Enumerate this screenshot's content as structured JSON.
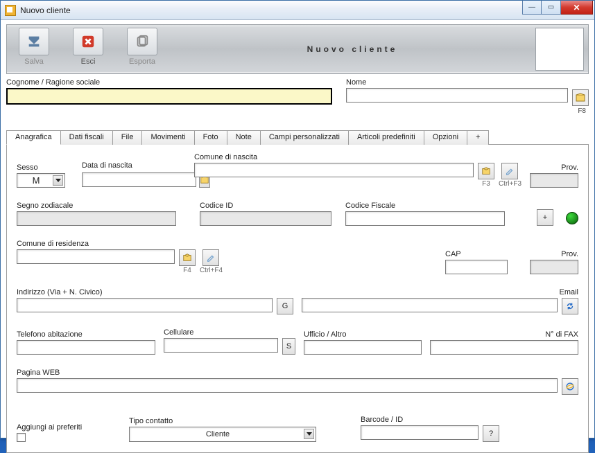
{
  "window": {
    "title": "Nuovo cliente"
  },
  "toolbar": {
    "save": "Salva",
    "exit": "Esci",
    "export": "Esporta",
    "title": "Nuovo cliente"
  },
  "top": {
    "cognome_label": "Cognome / Ragione sociale",
    "cognome_value": "",
    "nome_label": "Nome",
    "nome_value": "",
    "f8": "F8"
  },
  "tabs": {
    "anagrafica": "Anagrafica",
    "dati_fiscali": "Dati fiscali",
    "file": "File",
    "movimenti": "Movimenti",
    "foto": "Foto",
    "note": "Note",
    "campi": "Campi personalizzati",
    "articoli": "Articoli predefiniti",
    "opzioni": "Opzioni",
    "plus": "+"
  },
  "anag": {
    "sesso_label": "Sesso",
    "sesso_value": "M",
    "dn_label": "Data di nascita",
    "comune_nascita_label": "Comune di nascita",
    "prov_label": "Prov.",
    "f3": "F3",
    "ctrlf3": "Ctrl+F3",
    "zodiaco_label": "Segno zodiacale",
    "codiceid_label": "Codice ID",
    "cf_label": "Codice Fiscale",
    "plus": "+",
    "comune_res_label": "Comune di residenza",
    "cap_label": "CAP",
    "f4": "F4",
    "ctrlf4": "Ctrl+F4",
    "indirizzo_label": "Indirizzo (Via + N. Civico)",
    "email_label": "Email",
    "g": "G",
    "tel_label": "Telefono abitazione",
    "cell_label": "Cellulare",
    "s": "S",
    "ufficio_label": "Ufficio / Altro",
    "fax_label": "N° di FAX",
    "web_label": "Pagina WEB",
    "preferiti_label": "Aggiungi ai preferiti",
    "tipocontatto_label": "Tipo contatto",
    "tipocontatto_value": "Cliente",
    "barcode_label": "Barcode / ID",
    "qmark": "?"
  }
}
